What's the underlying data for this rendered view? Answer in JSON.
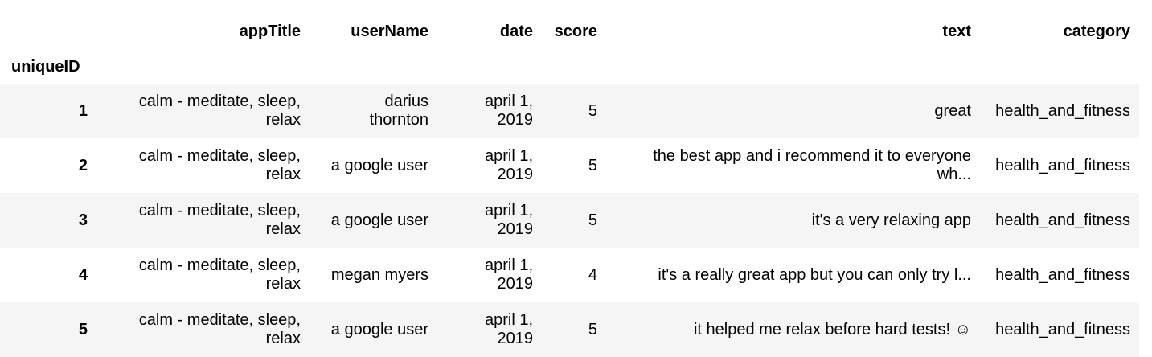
{
  "table": {
    "index_name": "uniqueID",
    "columns": [
      "appTitle",
      "userName",
      "date",
      "score",
      "text",
      "category"
    ],
    "rows": [
      {
        "id": "1",
        "appTitle": [
          "calm - meditate, sleep,",
          "relax"
        ],
        "userName": [
          "darius",
          "thornton"
        ],
        "date": [
          "april 1,",
          "2019"
        ],
        "score": "5",
        "text": [
          "great"
        ],
        "category": "health_and_fitness"
      },
      {
        "id": "2",
        "appTitle": [
          "calm - meditate, sleep,",
          "relax"
        ],
        "userName": [
          "a google user"
        ],
        "date": [
          "april 1,",
          "2019"
        ],
        "score": "5",
        "text": [
          "the best app and i recommend it to everyone",
          "wh..."
        ],
        "category": "health_and_fitness"
      },
      {
        "id": "3",
        "appTitle": [
          "calm - meditate, sleep,",
          "relax"
        ],
        "userName": [
          "a google user"
        ],
        "date": [
          "april 1,",
          "2019"
        ],
        "score": "5",
        "text": [
          "it's a very relaxing app"
        ],
        "category": "health_and_fitness"
      },
      {
        "id": "4",
        "appTitle": [
          "calm - meditate, sleep,",
          "relax"
        ],
        "userName": [
          "megan myers"
        ],
        "date": [
          "april 1,",
          "2019"
        ],
        "score": "4",
        "text": [
          "it's a really great app but you can only try l..."
        ],
        "category": "health_and_fitness"
      },
      {
        "id": "5",
        "appTitle": [
          "calm - meditate, sleep,",
          "relax"
        ],
        "userName": [
          "a google user"
        ],
        "date": [
          "april 1,",
          "2019"
        ],
        "score": "5",
        "text": [
          "it helped me relax before hard tests! ☺"
        ],
        "category": "health_and_fitness"
      }
    ]
  }
}
